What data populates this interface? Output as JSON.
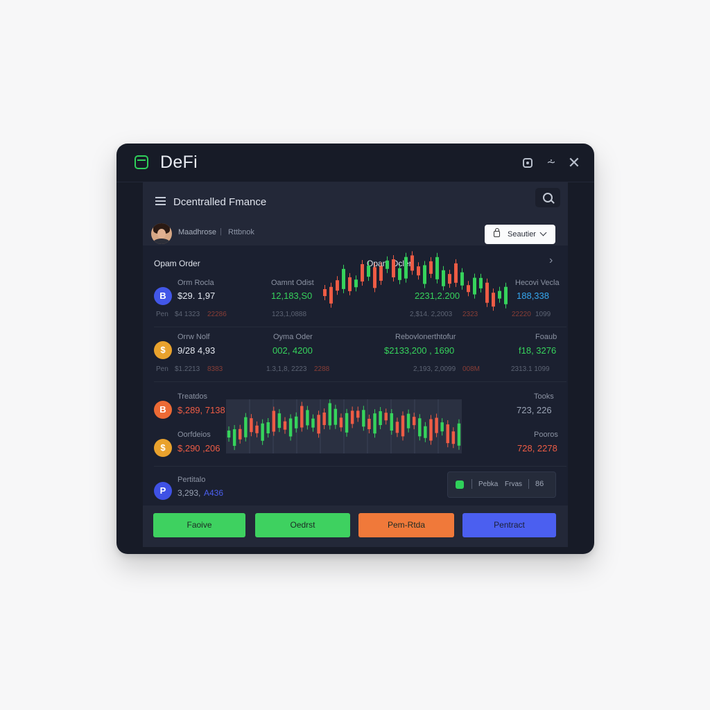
{
  "window": {
    "title": "DeFi",
    "controls": {
      "settings_icon": "settings-icon",
      "minimize_icon": "minimize-icon",
      "close_icon": "close-icon"
    }
  },
  "header": {
    "title": "Dcentralled Fmance",
    "user_name": "Maadhrose",
    "user_separator": "|",
    "user_status": "Rttbnok",
    "select_label": "Seautier"
  },
  "orders": {
    "left_heading": "Opam Order",
    "center_heading": "Opam Ocler.",
    "rows": [
      {
        "coin_symbol": "B",
        "coin_color": "#4257e8",
        "label_a": "Orm Rocla",
        "value_a": "$29. 1,97",
        "label_b": "Oamnt Odist",
        "value_b": "12,183,S0",
        "value_c": "2231,2.200",
        "label_d": "Hecovi Vecla",
        "value_d": "188,338",
        "sub_label": "Pen",
        "sub_a": "$4 1323",
        "sub_a_red": "22286",
        "sub_b": "123,1,0888",
        "sub_c": "2,$14. 2,2003",
        "sub_c_red": "2323",
        "sub_d_red": "22220",
        "sub_d": "1099"
      },
      {
        "coin_symbol": "$",
        "coin_color": "#e9a22d",
        "label_a": "Orrw Nolf",
        "value_a": "9/28 4,93",
        "label_b": "Oyma Oder",
        "value_b": "002, 4200",
        "label_c": "Rebovlonerthtofur",
        "value_c": "$2133,200 , 1690",
        "label_d": "Foaub",
        "value_d": "f18, 3276",
        "sub_label": "Pen",
        "sub_a": "$1.2213",
        "sub_a_red": "8383",
        "sub_b": "1.3,1,8, 2223",
        "sub_b_red": "2288",
        "sub_c": "2,193, 2,0099",
        "sub_c_red": "008M",
        "sub_d": "2313.1 1099"
      }
    ],
    "market": [
      {
        "coin_symbol": "B",
        "coin_color": "#ec6a35",
        "label": "Treatdos",
        "value": "$,289, 7138"
      },
      {
        "coin_symbol": "$",
        "coin_color": "#e9a22d",
        "label": "Oorfdeios",
        "value": "$,290 ,206"
      }
    ],
    "market_right": [
      {
        "label": "Tooks",
        "value": "723, 226"
      },
      {
        "label": "Pooros",
        "value": "728, 2278"
      }
    ],
    "portfolio": {
      "coin_symbol": "P",
      "coin_color": "#3f51e4",
      "label": "Pertitalo",
      "value_a": "3,293,",
      "value_b": "A436"
    },
    "pill": {
      "icon": "wallet-icon",
      "a": "Pebka",
      "b": "Frvas",
      "c": "86"
    }
  },
  "actions": [
    {
      "label": "Faoive",
      "color": "#3ed160"
    },
    {
      "label": "Oedrst",
      "color": "#3ed160"
    },
    {
      "label": "Pem-Rtda",
      "color": "#f0793a"
    },
    {
      "label": "Pentract",
      "color": "#4b5ff0"
    }
  ],
  "colors": {
    "up": "#36d35c",
    "down": "#ee5c45",
    "background": "#171b27"
  },
  "chart_data": [
    {
      "type": "candlestick",
      "title": "",
      "direction": [
        "down",
        "down",
        "down",
        "up",
        "down",
        "up",
        "down",
        "up",
        "down",
        "down",
        "up",
        "down",
        "up",
        "up",
        "down",
        "down",
        "up",
        "down",
        "up",
        "up",
        "down",
        "down",
        "up",
        "down",
        "up",
        "up",
        "down",
        "down",
        "up",
        "up"
      ]
    },
    {
      "type": "candlestick",
      "title": "",
      "direction": [
        "up",
        "up",
        "down",
        "up",
        "down",
        "down",
        "up",
        "up",
        "down",
        "up",
        "down",
        "up",
        "up",
        "down",
        "up",
        "up",
        "down",
        "down",
        "up",
        "up",
        "down",
        "up",
        "down",
        "down",
        "up",
        "down",
        "up",
        "up",
        "down",
        "up",
        "down",
        "down",
        "up",
        "down",
        "up",
        "up",
        "down",
        "down",
        "up",
        "down",
        "down",
        "up"
      ]
    }
  ]
}
